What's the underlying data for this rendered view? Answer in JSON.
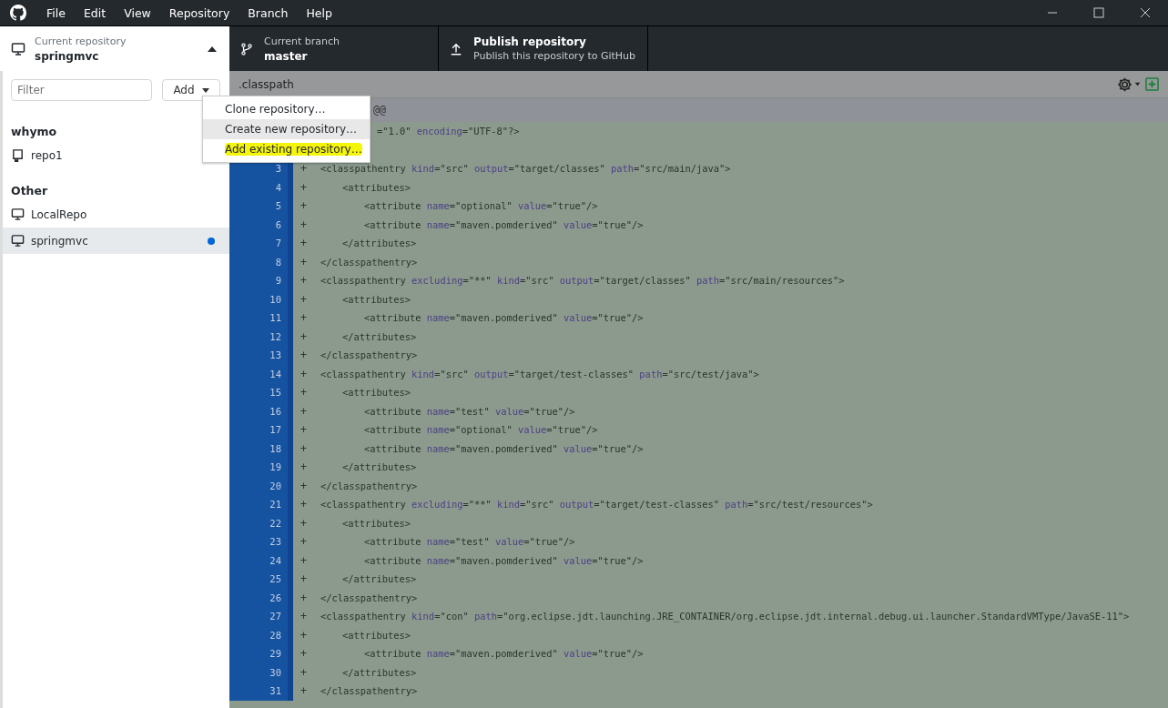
{
  "window": {
    "menu": [
      "File",
      "Edit",
      "View",
      "Repository",
      "Branch",
      "Help"
    ]
  },
  "toolbar": {
    "repository": {
      "label": "Current repository",
      "name": "springmvc",
      "expanded": true
    },
    "branch": {
      "label": "Current branch",
      "name": "master"
    },
    "publish": {
      "title": "Publish repository",
      "subtitle": "Publish this repository to GitHub"
    }
  },
  "sidebar": {
    "filter": {
      "placeholder": "Filter"
    },
    "add_button": "Add",
    "groups": [
      {
        "title": "whymo",
        "repos": [
          {
            "name": "repo1",
            "kind": "github",
            "selected": false,
            "changed": false
          }
        ]
      },
      {
        "title": "Other",
        "repos": [
          {
            "name": "LocalRepo",
            "kind": "local",
            "selected": false,
            "changed": false
          },
          {
            "name": "springmvc",
            "kind": "local",
            "selected": true,
            "changed": true
          }
        ]
      }
    ]
  },
  "add_menu": {
    "items": [
      {
        "label": "Clone repository…",
        "selected": false,
        "highlighted": false
      },
      {
        "label": "Create new repository…",
        "selected": true,
        "highlighted": false
      },
      {
        "label": "Add existing repository…",
        "selected": false,
        "highlighted": true
      }
    ]
  },
  "diff": {
    "file": ".classpath",
    "hunk_header": "@@",
    "lines": [
      {
        "kind": "partial",
        "text": "=\"1.0\" encoding=\"UTF-8\"?>"
      },
      {
        "kind": "hidden"
      },
      {
        "kind": "added",
        "number": "3",
        "marker": "+",
        "text": "<classpathentry kind=\"src\" output=\"target/classes\" path=\"src/main/java\">"
      },
      {
        "kind": "added",
        "number": "4",
        "marker": "+",
        "text": "\t<attributes>"
      },
      {
        "kind": "added",
        "number": "5",
        "marker": "+",
        "text": "\t\t<attribute name=\"optional\" value=\"true\"/>"
      },
      {
        "kind": "added",
        "number": "6",
        "marker": "+",
        "text": "\t\t<attribute name=\"maven.pomderived\" value=\"true\"/>"
      },
      {
        "kind": "added",
        "number": "7",
        "marker": "+",
        "text": "\t</attributes>"
      },
      {
        "kind": "added",
        "number": "8",
        "marker": "+",
        "text": "</classpathentry>"
      },
      {
        "kind": "added",
        "number": "9",
        "marker": "+",
        "text": "<classpathentry excluding=\"**\" kind=\"src\" output=\"target/classes\" path=\"src/main/resources\">"
      },
      {
        "kind": "added",
        "number": "10",
        "marker": "+",
        "text": "\t<attributes>"
      },
      {
        "kind": "added",
        "number": "11",
        "marker": "+",
        "text": "\t\t<attribute name=\"maven.pomderived\" value=\"true\"/>"
      },
      {
        "kind": "added",
        "number": "12",
        "marker": "+",
        "text": "\t</attributes>"
      },
      {
        "kind": "added",
        "number": "13",
        "marker": "+",
        "text": "</classpathentry>"
      },
      {
        "kind": "added",
        "number": "14",
        "marker": "+",
        "text": "<classpathentry kind=\"src\" output=\"target/test-classes\" path=\"src/test/java\">"
      },
      {
        "kind": "added",
        "number": "15",
        "marker": "+",
        "text": "\t<attributes>"
      },
      {
        "kind": "added",
        "number": "16",
        "marker": "+",
        "text": "\t\t<attribute name=\"test\" value=\"true\"/>"
      },
      {
        "kind": "added",
        "number": "17",
        "marker": "+",
        "text": "\t\t<attribute name=\"optional\" value=\"true\"/>"
      },
      {
        "kind": "added",
        "number": "18",
        "marker": "+",
        "text": "\t\t<attribute name=\"maven.pomderived\" value=\"true\"/>"
      },
      {
        "kind": "added",
        "number": "19",
        "marker": "+",
        "text": "\t</attributes>"
      },
      {
        "kind": "added",
        "number": "20",
        "marker": "+",
        "text": "</classpathentry>"
      },
      {
        "kind": "added",
        "number": "21",
        "marker": "+",
        "text": "<classpathentry excluding=\"**\" kind=\"src\" output=\"target/test-classes\" path=\"src/test/resources\">"
      },
      {
        "kind": "added",
        "number": "22",
        "marker": "+",
        "text": "\t<attributes>"
      },
      {
        "kind": "added",
        "number": "23",
        "marker": "+",
        "text": "\t\t<attribute name=\"test\" value=\"true\"/>"
      },
      {
        "kind": "added",
        "number": "24",
        "marker": "+",
        "text": "\t\t<attribute name=\"maven.pomderived\" value=\"true\"/>"
      },
      {
        "kind": "added",
        "number": "25",
        "marker": "+",
        "text": "\t</attributes>"
      },
      {
        "kind": "added",
        "number": "26",
        "marker": "+",
        "text": "</classpathentry>"
      },
      {
        "kind": "added",
        "number": "27",
        "marker": "+",
        "text": "<classpathentry kind=\"con\" path=\"org.eclipse.jdt.launching.JRE_CONTAINER/org.eclipse.jdt.internal.debug.ui.launcher.StandardVMType/JavaSE-11\">"
      },
      {
        "kind": "added",
        "number": "28",
        "marker": "+",
        "text": "\t<attributes>"
      },
      {
        "kind": "added",
        "number": "29",
        "marker": "+",
        "text": "\t\t<attribute name=\"maven.pomderived\" value=\"true\"/>"
      },
      {
        "kind": "added",
        "number": "30",
        "marker": "+",
        "text": "\t</attributes>"
      },
      {
        "kind": "added",
        "number": "31",
        "marker": "+",
        "text": "</classpathentry>"
      }
    ]
  }
}
